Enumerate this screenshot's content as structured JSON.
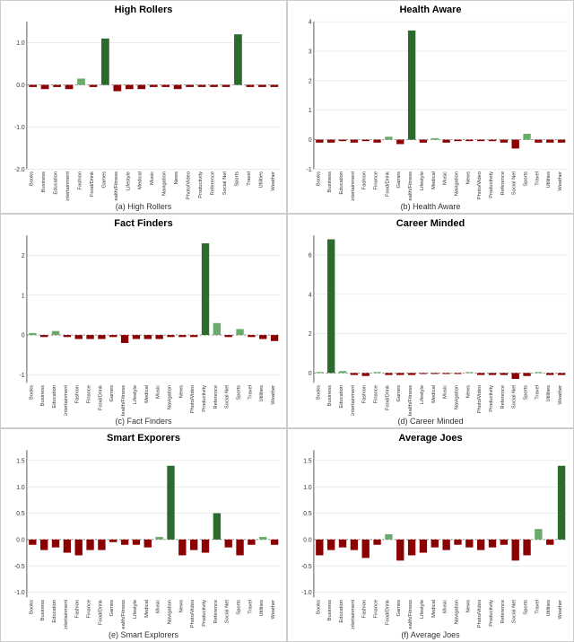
{
  "panels": [
    {
      "id": "high-rollers",
      "title": "High Rollers",
      "caption": "(a) High Rollers",
      "yLabels": [
        "-2.0",
        "1.0",
        "0.0",
        "-1.0"
      ],
      "yMin": -2.0,
      "yMax": 1.5,
      "categories": [
        "Books",
        "Business",
        "Education",
        "Entertainment",
        "Fashion",
        "Food/Drink",
        "Games",
        "Health/Fitness",
        "Lifestyle",
        "Medical",
        "Music",
        "Navigation",
        "News",
        "Photo/Video",
        "Productivity",
        "Reference",
        "Social Net",
        "Sports",
        "Travel",
        "Utilities",
        "Weather"
      ],
      "values": [
        -0.05,
        -0.1,
        -0.05,
        -0.1,
        0.15,
        -0.05,
        1.1,
        -0.15,
        -0.1,
        -0.1,
        -0.05,
        -0.05,
        -0.1,
        -0.05,
        -0.05,
        -0.05,
        -0.05,
        1.2,
        -0.05,
        -0.05,
        -0.05
      ]
    },
    {
      "id": "health-aware",
      "title": "Health Aware",
      "caption": "(b) Health Aware",
      "yMin": -1.0,
      "yMax": 4.0,
      "yLabels": [
        "4",
        "3",
        "2",
        "1",
        "0",
        "-1"
      ],
      "categories": [
        "Books",
        "Business",
        "Education",
        "Entertainment",
        "Fashion",
        "Finance",
        "Food/Drink",
        "Games",
        "Health/Fitness",
        "Lifestyle",
        "Medical",
        "Music",
        "Navigation",
        "News",
        "Photo/Video",
        "Productivity",
        "Reference",
        "Social Net",
        "Sports",
        "Travel",
        "Utilities",
        "Weather"
      ],
      "values": [
        -0.1,
        -0.1,
        -0.05,
        -0.1,
        -0.05,
        -0.1,
        0.1,
        -0.15,
        3.7,
        -0.1,
        0.05,
        -0.1,
        -0.05,
        -0.05,
        -0.05,
        -0.05,
        -0.1,
        -0.3,
        0.2,
        -0.1,
        -0.1,
        -0.1
      ]
    },
    {
      "id": "fact-finders",
      "title": "Fact Finders",
      "caption": "(c) Fact Finders",
      "yMin": -1.2,
      "yMax": 2.5,
      "yLabels": [
        "2",
        "1",
        "0",
        "-1"
      ],
      "categories": [
        "Books",
        "Business",
        "Education",
        "Entertainment",
        "Fashion",
        "Finance",
        "Food/Drink",
        "Games",
        "Health/Fitness",
        "Lifestyle",
        "Medical",
        "Music",
        "Navigation",
        "News",
        "Photo/Video",
        "Productivity",
        "Reference",
        "Social Net",
        "Sports",
        "Travel",
        "Utilities",
        "Weather"
      ],
      "values": [
        0.05,
        -0.05,
        0.1,
        -0.05,
        -0.1,
        -0.1,
        -0.1,
        -0.05,
        -0.2,
        -0.1,
        -0.1,
        -0.1,
        -0.05,
        -0.05,
        -0.05,
        2.3,
        0.3,
        -0.05,
        0.15,
        -0.05,
        -0.1,
        -0.15
      ]
    },
    {
      "id": "career-minded",
      "title": "Career Minded",
      "caption": "(d) Career Minded",
      "yMin": -0.5,
      "yMax": 7.0,
      "yLabels": [
        "6",
        "4",
        "2",
        "0"
      ],
      "categories": [
        "Books",
        "Business",
        "Education",
        "Entertainment",
        "Fashion",
        "Finance",
        "Food/Drink",
        "Games",
        "Health/Fitness",
        "Lifestyle",
        "Medical",
        "Music",
        "Navigation",
        "News",
        "Photo/Video",
        "Productivity",
        "Reference",
        "Social Net",
        "Sports",
        "Travel",
        "Utilities",
        "Weather"
      ],
      "values": [
        0.05,
        6.8,
        0.1,
        -0.1,
        -0.15,
        0.05,
        -0.1,
        -0.1,
        -0.1,
        -0.05,
        -0.05,
        -0.05,
        -0.05,
        0.05,
        -0.1,
        -0.1,
        -0.1,
        -0.3,
        -0.15,
        0.05,
        -0.1,
        -0.1
      ]
    },
    {
      "id": "smart-explorers",
      "title": "Smart Exporers",
      "caption": "(e) Smart Explorers",
      "yMin": -1.1,
      "yMax": 1.7,
      "yLabels": [
        "1.5",
        "1.0",
        "0.5",
        "0.0",
        "-0.5",
        "-1.0"
      ],
      "categories": [
        "Books",
        "Business",
        "Education",
        "Entertainment",
        "Fashion",
        "Finance",
        "Food/Drink",
        "Games",
        "Health/Fitness",
        "Lifestyle",
        "Medical",
        "Music",
        "Navigation",
        "News",
        "Photo/Video",
        "Productivity",
        "Reference",
        "Social Net",
        "Sports",
        "Travel",
        "Utilities",
        "Weather"
      ],
      "values": [
        -0.1,
        -0.2,
        -0.15,
        -0.25,
        -0.3,
        -0.2,
        -0.2,
        -0.05,
        -0.1,
        -0.1,
        -0.15,
        0.05,
        1.4,
        -0.3,
        -0.2,
        -0.25,
        0.5,
        -0.15,
        -0.3,
        -0.1,
        0.05,
        -0.1
      ]
    },
    {
      "id": "average-joes",
      "title": "Average Joes",
      "caption": "(f) Average Joes",
      "yMin": -1.1,
      "yMax": 1.7,
      "yLabels": [
        "1.5",
        "1.0",
        "0.5",
        "0.0",
        "-0.5",
        "-1.0"
      ],
      "categories": [
        "Books",
        "Business",
        "Education",
        "Entertainment",
        "Fashion",
        "Finance",
        "Food/Drink",
        "Games",
        "Health/Fitness",
        "Lifestyle",
        "Medical",
        "Music",
        "Navigation",
        "News",
        "Photo/Video",
        "Productivity",
        "Reference",
        "Social Net",
        "Sports",
        "Travel",
        "Utilities",
        "Weather"
      ],
      "values": [
        -0.3,
        -0.2,
        -0.15,
        -0.2,
        -0.35,
        -0.1,
        0.1,
        -0.4,
        -0.3,
        -0.25,
        -0.15,
        -0.2,
        -0.1,
        -0.15,
        -0.2,
        -0.15,
        -0.1,
        -0.4,
        -0.3,
        0.2,
        -0.1,
        1.4
      ]
    }
  ]
}
